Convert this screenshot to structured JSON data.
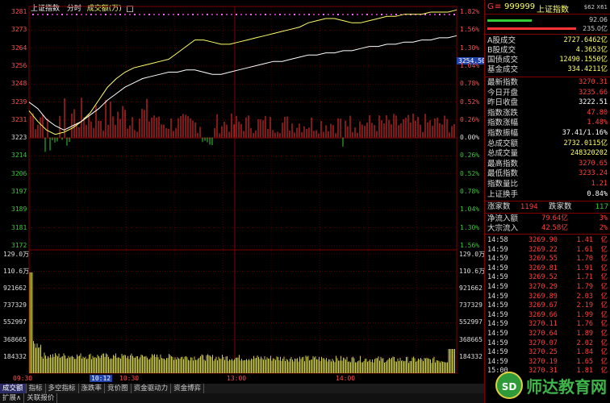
{
  "chart_header": {
    "title": "上证指数",
    "mode": "分时",
    "sub": "成交额(万)"
  },
  "colors": {
    "up": "#ff3333",
    "down": "#33cc33",
    "price_line": "#ffffff",
    "avg_line": "#ffff66",
    "grid": "#800000"
  },
  "chart_data": {
    "type": "line",
    "title": "上证指数",
    "prev_close": 3222.51,
    "y_ticks_left": [
      "3281",
      "3273",
      "3264",
      "3256",
      "3248",
      "3239",
      "3231",
      "3223",
      "3214",
      "3206",
      "3197",
      "3189",
      "3181",
      "3172"
    ],
    "y_ticks_right": [
      "1.82%",
      "1.56%",
      "1.30%",
      "1.04%",
      "0.78%",
      "0.52%",
      "0.26%",
      "0.00%",
      "0.26%",
      "0.52%",
      "0.78%",
      "1.04%",
      "1.30%",
      "1.56%"
    ],
    "current_value_label": "3254.50",
    "vol_ticks_left": [
      "129.0万",
      "110.6万",
      "921662",
      "737329",
      "552997",
      "368665",
      "184332"
    ],
    "vol_ticks_right": [
      "129.0万",
      "110.6万",
      "921662",
      "737329",
      "552997",
      "368665",
      "184332"
    ],
    "x_ticks": [
      "09:30",
      "10:12",
      "10:30",
      "13:00",
      "14:00"
    ],
    "price_series": [
      3239,
      3236,
      3231,
      3228,
      3226,
      3228,
      3230,
      3233,
      3236,
      3240,
      3243,
      3246,
      3248,
      3250,
      3251,
      3252,
      3253,
      3253,
      3254,
      3254,
      3253,
      3252,
      3252,
      3253,
      3254,
      3255,
      3256,
      3257,
      3258,
      3258,
      3259,
      3260,
      3261,
      3261,
      3262,
      3262,
      3263,
      3263,
      3264,
      3265,
      3265,
      3266,
      3266,
      3267,
      3267,
      3268,
      3268,
      3269,
      3269,
      3270
    ],
    "avg_series": [
      3235,
      3230,
      3226,
      3224,
      3225,
      3227,
      3230,
      3234,
      3240,
      3246,
      3250,
      3253,
      3255,
      3256,
      3257,
      3258,
      3259,
      3262,
      3265,
      3268,
      3268,
      3267,
      3266,
      3266,
      3267,
      3268,
      3269,
      3270,
      3271,
      3272,
      3273,
      3274,
      3276,
      3277,
      3278,
      3278,
      3277,
      3276,
      3276,
      3277,
      3278,
      3279,
      3279,
      3280,
      3280,
      3280,
      3281,
      3281,
      3281,
      3282
    ]
  },
  "right_panel": {
    "header_code": "999999",
    "header_name": "上证指数",
    "header_letter": "G",
    "header_small": "$62 X61",
    "bar_pct_1": "92.06",
    "bar_pct_2": "235.0亿",
    "stats1": [
      {
        "label": "A股成交",
        "value": "2727.6462亿",
        "color": "#ffff66"
      },
      {
        "label": "B股成交",
        "value": "4.3653亿",
        "color": "#ffff66"
      },
      {
        "label": "国债成交",
        "value": "12490.1550亿",
        "color": "#ffff66"
      },
      {
        "label": "基金成交",
        "value": "334.4211亿",
        "color": "#ffff66"
      }
    ],
    "stats2": [
      {
        "label": "最新指数",
        "value": "3270.31",
        "color": "#ff4040"
      },
      {
        "label": "今日开盘",
        "value": "3235.66",
        "color": "#ff4040"
      },
      {
        "label": "昨日收盘",
        "value": "3222.51",
        "color": "#ffffff"
      },
      {
        "label": "指数涨跌",
        "value": "47.80",
        "color": "#ff4040"
      },
      {
        "label": "指数涨幅",
        "value": "1.48%",
        "color": "#ff4040"
      },
      {
        "label": "指数振幅",
        "value": "37.41/1.16%",
        "color": "#ffffff"
      },
      {
        "label": "总成交额",
        "value": "2732.0115亿",
        "color": "#ffff66"
      },
      {
        "label": "总成交量",
        "value": "248320202",
        "color": "#ffff66"
      },
      {
        "label": "最高指数",
        "value": "3270.65",
        "color": "#ff4040"
      },
      {
        "label": "最低指数",
        "value": "3233.24",
        "color": "#ff4040"
      },
      {
        "label": "指数量比",
        "value": "1.21",
        "color": "#ff4040"
      },
      {
        "label": "上证换手",
        "value": "0.84%",
        "color": "#ffffff"
      }
    ],
    "up_label": "涨家数",
    "up_value": "1194",
    "down_label": "跌家数",
    "down_value": "117",
    "flow": [
      {
        "label": "净流入额",
        "value": "79.64亿",
        "pct": "3%"
      },
      {
        "label": "大宗流入",
        "value": "42.58亿",
        "pct": "2%"
      }
    ],
    "ticks": [
      {
        "t": "14:58",
        "p": "3269.90",
        "v": "1.41",
        "u": "亿"
      },
      {
        "t": "14:59",
        "p": "3269.22",
        "v": "1.61",
        "u": "亿"
      },
      {
        "t": "14:59",
        "p": "3269.55",
        "v": "1.70",
        "u": "亿"
      },
      {
        "t": "14:59",
        "p": "3269.81",
        "v": "1.91",
        "u": "亿"
      },
      {
        "t": "14:59",
        "p": "3269.52",
        "v": "1.71",
        "u": "亿"
      },
      {
        "t": "14:59",
        "p": "3270.29",
        "v": "1.79",
        "u": "亿"
      },
      {
        "t": "14:59",
        "p": "3269.89",
        "v": "2.03",
        "u": "亿"
      },
      {
        "t": "14:59",
        "p": "3269.67",
        "v": "2.19",
        "u": "亿"
      },
      {
        "t": "14:59",
        "p": "3269.66",
        "v": "1.99",
        "u": "亿"
      },
      {
        "t": "14:59",
        "p": "3270.11",
        "v": "1.76",
        "u": "亿"
      },
      {
        "t": "14:59",
        "p": "3270.64",
        "v": "1.89",
        "u": "亿"
      },
      {
        "t": "14:59",
        "p": "3270.07",
        "v": "2.02",
        "u": "亿"
      },
      {
        "t": "14:59",
        "p": "3270.25",
        "v": "1.84",
        "u": "亿"
      },
      {
        "t": "14:59",
        "p": "3270.19",
        "v": "1.65",
        "u": "亿"
      },
      {
        "t": "15:00",
        "p": "3270.31",
        "v": "1.81",
        "u": "亿"
      }
    ]
  },
  "tabs": [
    "成交额",
    "指标",
    "多空指标",
    "涨跌率",
    "竞价图",
    "资金驱动力",
    "资金博弈"
  ],
  "tabs_row2": [
    "扩展∧",
    "关联报价"
  ],
  "watermark": {
    "text": "师达教育网",
    "badge": "SD"
  }
}
